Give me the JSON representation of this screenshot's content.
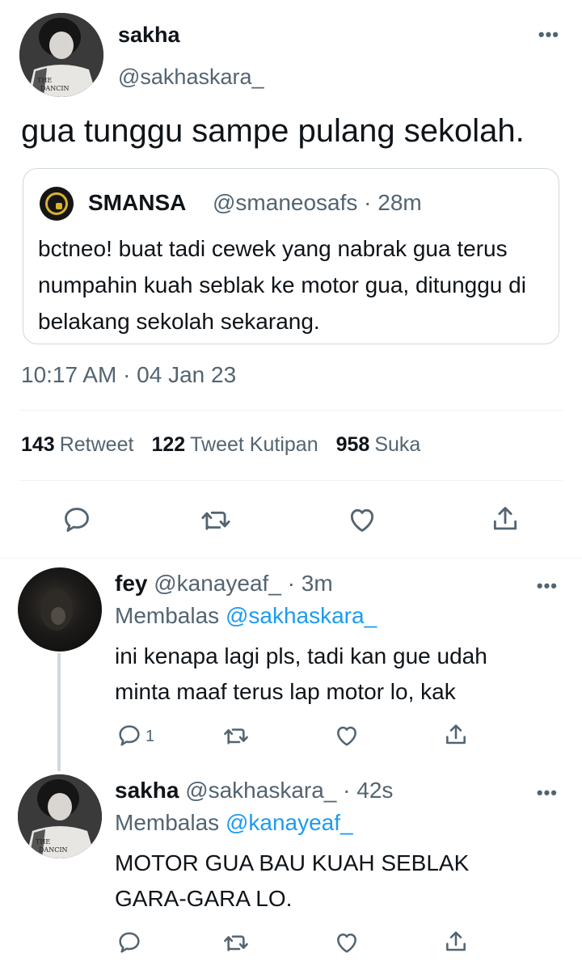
{
  "main_tweet": {
    "name": "sakha",
    "handle": "@sakhaskara_",
    "text": "gua tunggu sampe pulang sekolah.",
    "avatar_shirt_text": "THE DANCIN KI",
    "quoted": {
      "name": "SMANSA",
      "meta": "@smaneosafs · 28m",
      "text": "bctneo! buat tadi cewek yang nabrak gua terus numpahin kuah seblak ke motor gua, ditunggu di belakang sekolah sekarang."
    },
    "timestamp": "10:17 AM · 04 Jan 23",
    "stats": {
      "retweets_count": "143",
      "retweets_label": "Retweet",
      "quotes_count": "122",
      "quotes_label": "Tweet Kutipan",
      "likes_count": "958",
      "likes_label": "Suka"
    }
  },
  "replies": [
    {
      "name": "fey",
      "meta": "@kanayeaf_ · 3m",
      "replying_label": "Membalas",
      "replying_to": "@sakhaskara_",
      "text_line1": "ini kenapa lagi pls, tadi kan gue udah",
      "text_line2": "minta maaf terus lap motor lo, kak",
      "reply_count": "1"
    },
    {
      "name": "sakha",
      "meta": "@sakhaskara_ · 42s",
      "replying_label": "Membalas",
      "replying_to": "@kanayeaf_",
      "text_line1": "MOTOR GUA BAU KUAH SEBLAK",
      "text_line2": "GARA-GARA LO.",
      "reply_count": ""
    }
  ],
  "more_glyph": "•••",
  "icons": [
    "reply-icon",
    "retweet-icon",
    "like-icon",
    "share-icon",
    "more-icon"
  ],
  "colors": {
    "link": "#1d9bf0",
    "muted": "#536471",
    "text": "#0f1419",
    "divider": "#eff3f4"
  }
}
